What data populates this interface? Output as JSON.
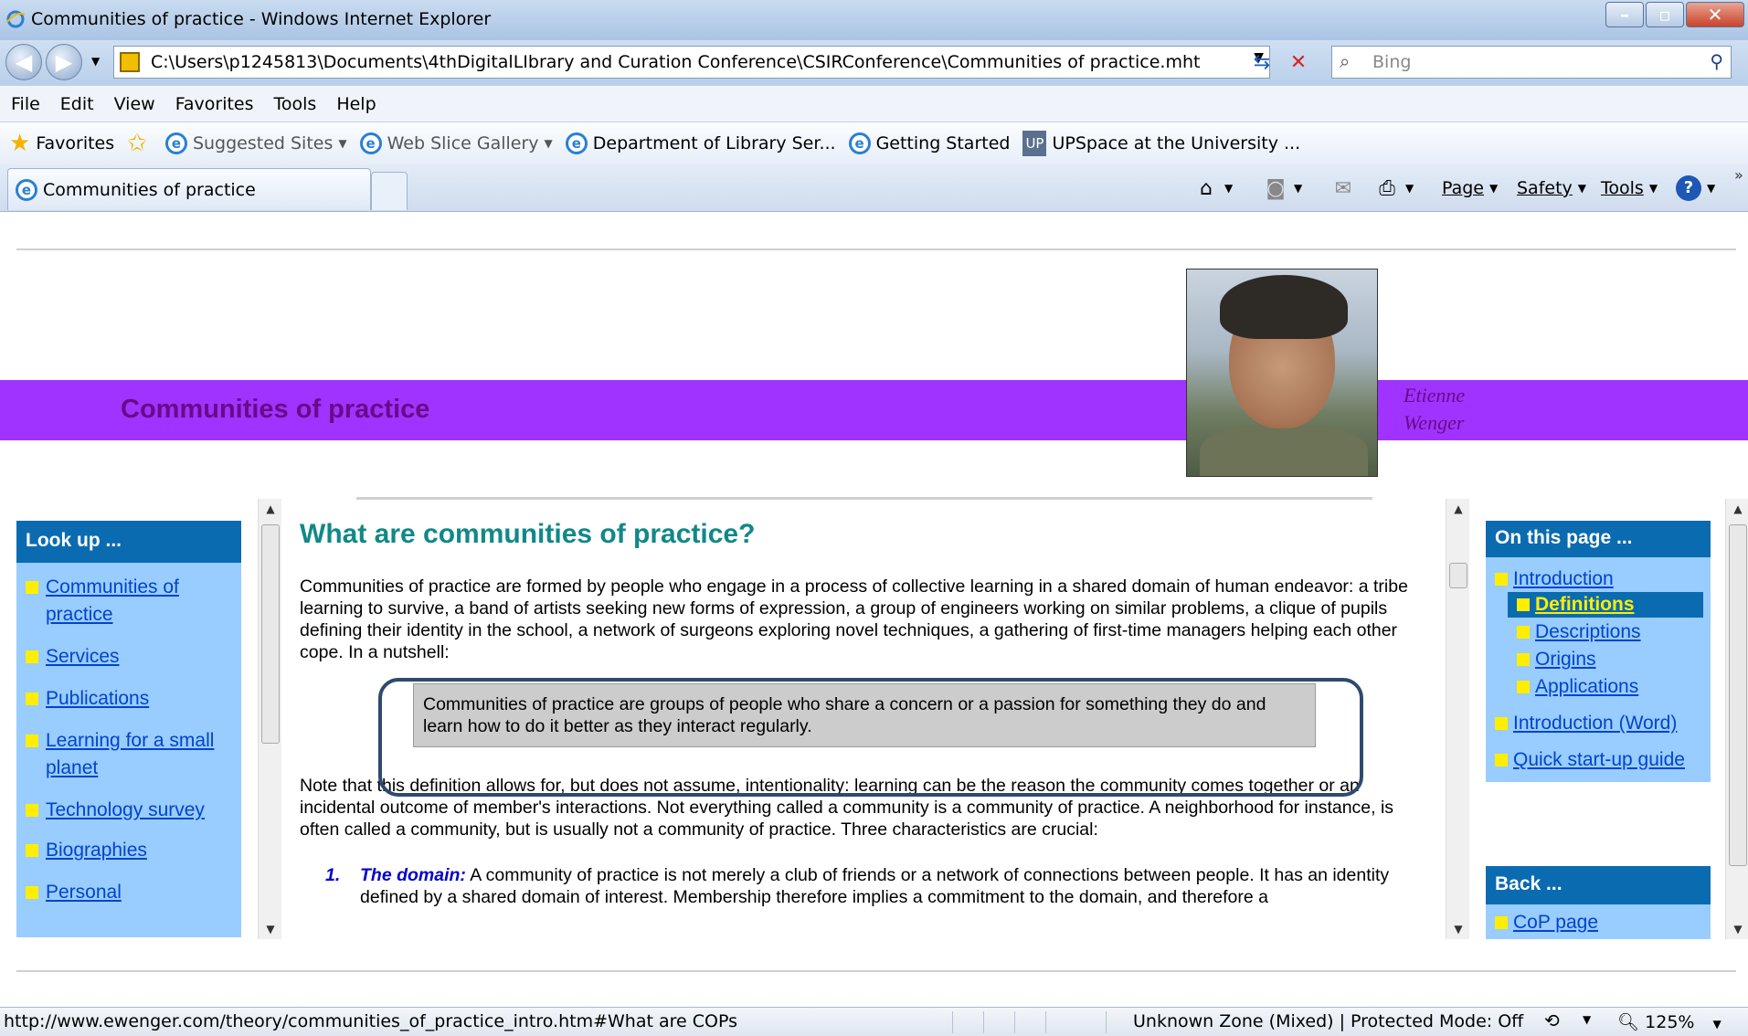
{
  "window": {
    "title": "Communities of practice - Windows Internet Explorer"
  },
  "address_bar": {
    "url": "C:\\Users\\p1245813\\Documents\\4thDigitalLIbrary and Curation Conference\\CSIRConference\\Communities of practice.mht",
    "search_placeholder": "Bing"
  },
  "menu": [
    "File",
    "Edit",
    "View",
    "Favorites",
    "Tools",
    "Help"
  ],
  "favorites_bar": {
    "favorites_label": "Favorites",
    "items": [
      "Suggested Sites",
      "Web Slice Gallery",
      "Department of Library Ser...",
      "Getting Started",
      "UPSpace at the University ..."
    ]
  },
  "tabs": {
    "active_tab": "Communities of practice"
  },
  "command_bar": {
    "page": "Page",
    "safety": "Safety",
    "tools": "Tools"
  },
  "page": {
    "banner_title": "Communities of practice",
    "author_line1": "Etienne",
    "author_line2": "Wenger",
    "lookup": {
      "header": "Look up ...",
      "links": [
        "Communities of practice",
        "Services",
        "Publications",
        "Learning for a small planet",
        "Technology survey",
        "Biographies",
        "Personal"
      ]
    },
    "on_this_page": {
      "header": "On this page ...",
      "links": [
        "Introduction",
        "Definitions",
        "Descriptions",
        "Origins",
        "Applications",
        "Introduction (Word)",
        "Quick start-up guide"
      ]
    },
    "back": {
      "header": "Back ...",
      "links": [
        "CoP page"
      ]
    },
    "content": {
      "heading": "What are communities of practice?",
      "intro": "Communities of practice are formed by people who engage in a process of collective learning in a shared domain of human endeavor: a tribe learning to survive, a band of artists seeking new forms of expression, a group of engineers working on similar problems, a clique of pupils defining their identity in the school, a network of surgeons exploring novel techniques, a gathering of first-time managers helping each other cope. In a nutshell:",
      "definition": "Communities of practice are groups of people who share a concern or a passion for something they do and learn how to do it better as they interact regularly.",
      "note": "Note that this definition allows for, but does not assume, intentionality: learning can be the reason the community comes together or an incidental outcome of member's interactions. Not everything called a community is a community of practice. A neighborhood for instance, is often called a community, but is usually not a community of practice. Three characteristics are crucial:",
      "item1_num": "1.",
      "item1_term": "The domain:",
      "item1_text": " A community of practice is not merely a club of friends or a network of connections between people. It has an identity defined by a shared domain of interest. Membership therefore implies a commitment to the domain, and therefore a"
    }
  },
  "status_bar": {
    "url": "http://www.ewenger.com/theory/communities_of_practice_intro.htm#What are COPs",
    "zone": "Unknown Zone (Mixed) | Protected Mode: Off",
    "zoom": "125%"
  }
}
